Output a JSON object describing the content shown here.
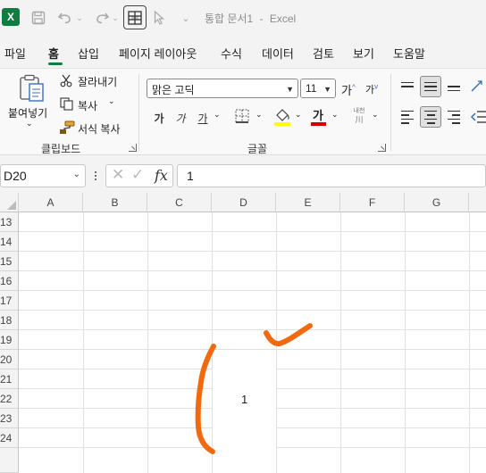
{
  "window": {
    "document_title": "통합 문서1",
    "separator": "-",
    "app_name": "Excel",
    "icons": [
      "excel-logo-icon",
      "save-icon",
      "undo-icon",
      "redo-icon",
      "table-tool-icon",
      "pointer-icon",
      "customize-qat-icon"
    ]
  },
  "menu": {
    "tabs": [
      "파일",
      "홈",
      "삽입",
      "페이지 레이아웃",
      "수식",
      "데이터",
      "검토",
      "보기",
      "도움말"
    ],
    "active_tab": "홈"
  },
  "ribbon": {
    "clipboard": {
      "paste_label": "붙여넣기",
      "cut_label": "잘라내기",
      "copy_label": "복사",
      "format_painter_label": "서식 복사",
      "group_label": "클립보드"
    },
    "font": {
      "font_name": "맑은 고딕",
      "font_size": "11",
      "grow_font": "가",
      "shrink_font": "가",
      "bold": "가",
      "italic": "가",
      "underline": "가",
      "font_color_glyph": "가",
      "phonetic_glyph": "내천",
      "group_label": "글꼴",
      "highlight_color": "#ffff00",
      "font_color": "#d00000"
    }
  },
  "formula_bar": {
    "name_box": "D20",
    "formula_value": "1",
    "fx_label": "fx"
  },
  "sheet": {
    "columns": [
      "A",
      "B",
      "C",
      "D",
      "E",
      "F",
      "G"
    ],
    "rows": [
      "13",
      "14",
      "15",
      "16",
      "17",
      "18",
      "19",
      "20",
      "21",
      "22",
      "23",
      "24"
    ],
    "cell_value": "1",
    "ink_color": "#f26a10",
    "accent_green": "#107c41"
  }
}
